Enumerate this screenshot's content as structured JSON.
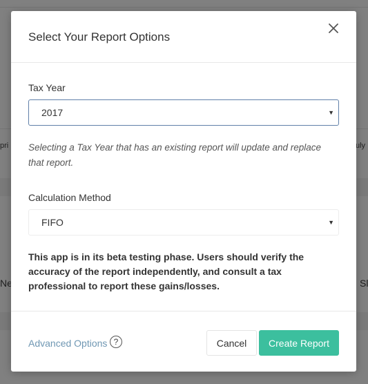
{
  "background": {
    "fragments": [
      "pri",
      "uly",
      "Net",
      "Sl"
    ]
  },
  "modal": {
    "title": "Select Your Report Options",
    "close_icon": "close-icon",
    "tax_year": {
      "label": "Tax Year",
      "value": "2017",
      "help": "Selecting a Tax Year that has an existing report will update and replace that report."
    },
    "calculation_method": {
      "label": "Calculation Method",
      "value": "FIFO"
    },
    "warning": "This app is in its beta testing phase. Users should verify the accuracy of the report independently, and consult a tax professional to report these gains/losses.",
    "footer": {
      "advanced_options": "Advanced Options",
      "help_icon_glyph": "?",
      "cancel": "Cancel",
      "create_report": "Create Report"
    }
  },
  "colors": {
    "accent": "#3cbf9e",
    "link": "#6f97b3",
    "focus_border": "#5f7fa8"
  }
}
